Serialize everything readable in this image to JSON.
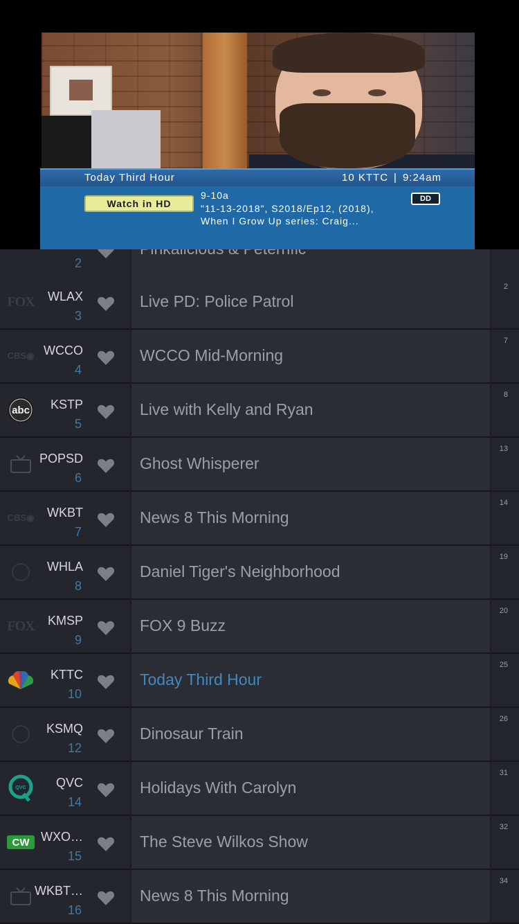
{
  "player": {
    "osd": {
      "program_title": "Today Third Hour",
      "channel": "10 KTTC",
      "separator": "|",
      "clock": "9:24am",
      "watch_label": "Watch in HD",
      "time_slot": "9-10a",
      "desc_line1": "\"11-13-2018\", S2018/Ep12, (2018),",
      "desc_line2": "When I Grow Up series: Craig...",
      "audio_badge": "DD"
    }
  },
  "guide": {
    "partial_row": {
      "title": "Pinkalicious & Peterrific",
      "number": "2"
    },
    "rows": [
      {
        "logo": "FOX",
        "callsign": "WLAX",
        "number": "3",
        "title": "Live PD: Police Patrol",
        "side": "2"
      },
      {
        "logo": "CBS",
        "callsign": "WCCO",
        "number": "4",
        "title": "WCCO Mid-Morning",
        "side": "7"
      },
      {
        "logo": "abc",
        "callsign": "KSTP",
        "number": "5",
        "title": "Live with Kelly and Ryan",
        "side": "8"
      },
      {
        "logo": "tv",
        "callsign": "POPSD",
        "number": "6",
        "title": "Ghost Whisperer",
        "side": "13"
      },
      {
        "logo": "CBS",
        "callsign": "WKBT",
        "number": "7",
        "title": "News 8 This Morning",
        "side": "14"
      },
      {
        "logo": "PBS",
        "callsign": "WHLA",
        "number": "8",
        "title": "Daniel Tiger's Neighborhood",
        "side": "19"
      },
      {
        "logo": "FOX",
        "callsign": "KMSP",
        "number": "9",
        "title": "FOX 9 Buzz",
        "side": "20"
      },
      {
        "logo": "nbc",
        "callsign": "KTTC",
        "number": "10",
        "title": "Today Third Hour",
        "side": "25",
        "active": true
      },
      {
        "logo": "PBS",
        "callsign": "KSMQ",
        "number": "12",
        "title": "Dinosaur Train",
        "side": "26"
      },
      {
        "logo": "qvc",
        "callsign": "QVC",
        "number": "14",
        "title": "Holidays With Carolyn",
        "side": "31"
      },
      {
        "logo": "cw",
        "callsign": "WXO…",
        "number": "15",
        "title": "The Steve Wilkos Show",
        "side": "32"
      },
      {
        "logo": "tv",
        "callsign": "WKBT…",
        "number": "16",
        "title": "News 8 This Morning",
        "side": "34"
      }
    ]
  },
  "colors": {
    "active_title": "#3f8bc0",
    "channel_number": "#3d7aa8",
    "osd_blue": "#1f6aa6"
  }
}
